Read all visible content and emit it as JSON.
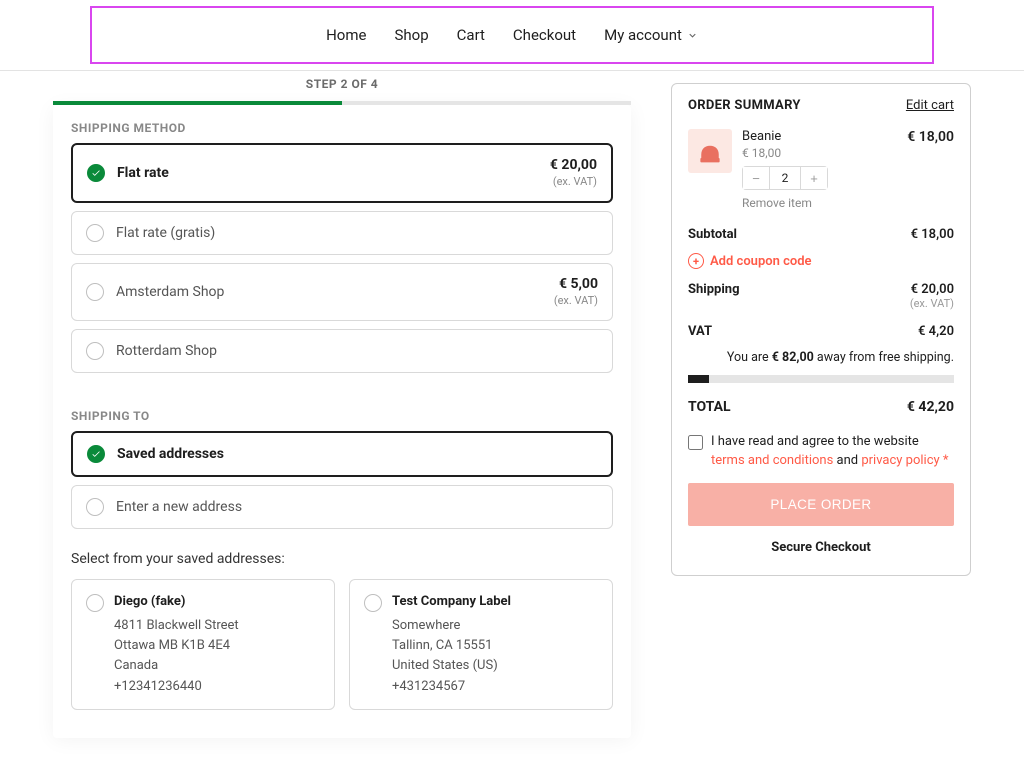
{
  "nav": {
    "home": "Home",
    "shop": "Shop",
    "cart": "Cart",
    "checkout": "Checkout",
    "account": "My account"
  },
  "step_label": "STEP 2 OF 4",
  "sections": {
    "shipping_method": "SHIPPING METHOD",
    "shipping_to": "SHIPPING TO"
  },
  "shipping_options": [
    {
      "label": "Flat rate",
      "price": "€ 20,00",
      "exvat": "(ex. VAT)"
    },
    {
      "label": "Flat rate (gratis)",
      "price": "",
      "exvat": ""
    },
    {
      "label": "Amsterdam Shop",
      "price": "€ 5,00",
      "exvat": "(ex. VAT)"
    },
    {
      "label": "Rotterdam Shop",
      "price": "",
      "exvat": ""
    }
  ],
  "shipto_options": {
    "saved": "Saved addresses",
    "new": "Enter a new address"
  },
  "addresses_prompt": "Select from your saved addresses:",
  "addresses": [
    {
      "name": "Diego (fake)",
      "l1": "4811 Blackwell Street",
      "l2": "Ottawa MB K1B 4E4",
      "l3": "Canada",
      "phone": "+12341236440"
    },
    {
      "name": "Test Company Label",
      "l1": "Somewhere",
      "l2": "Tallinn, CA 15551",
      "l3": "United States (US)",
      "phone": "+431234567"
    }
  ],
  "summary": {
    "title": "ORDER SUMMARY",
    "edit": "Edit cart",
    "item": {
      "name": "Beanie",
      "unit_price": "€ 18,00",
      "qty": "2",
      "line_price": "€ 18,00",
      "remove": "Remove item"
    },
    "subtotal": {
      "label": "Subtotal",
      "value": "€ 18,00"
    },
    "coupon": "Add coupon code",
    "shipping": {
      "label": "Shipping",
      "value": "€ 20,00",
      "ex": "(ex. VAT)"
    },
    "vat": {
      "label": "VAT",
      "value": "€ 4,20"
    },
    "freeship_pre": "You are ",
    "freeship_amount": "€ 82,00",
    "freeship_post": " away from free shipping.",
    "total": {
      "label": "TOTAL",
      "value": "€ 42,20"
    },
    "terms_pre": "I have read and agree to the website ",
    "terms_link": "terms and conditions",
    "terms_and": " and ",
    "privacy_link": "privacy policy",
    "star": " *",
    "place": "PLACE ORDER",
    "secure": "Secure Checkout"
  }
}
